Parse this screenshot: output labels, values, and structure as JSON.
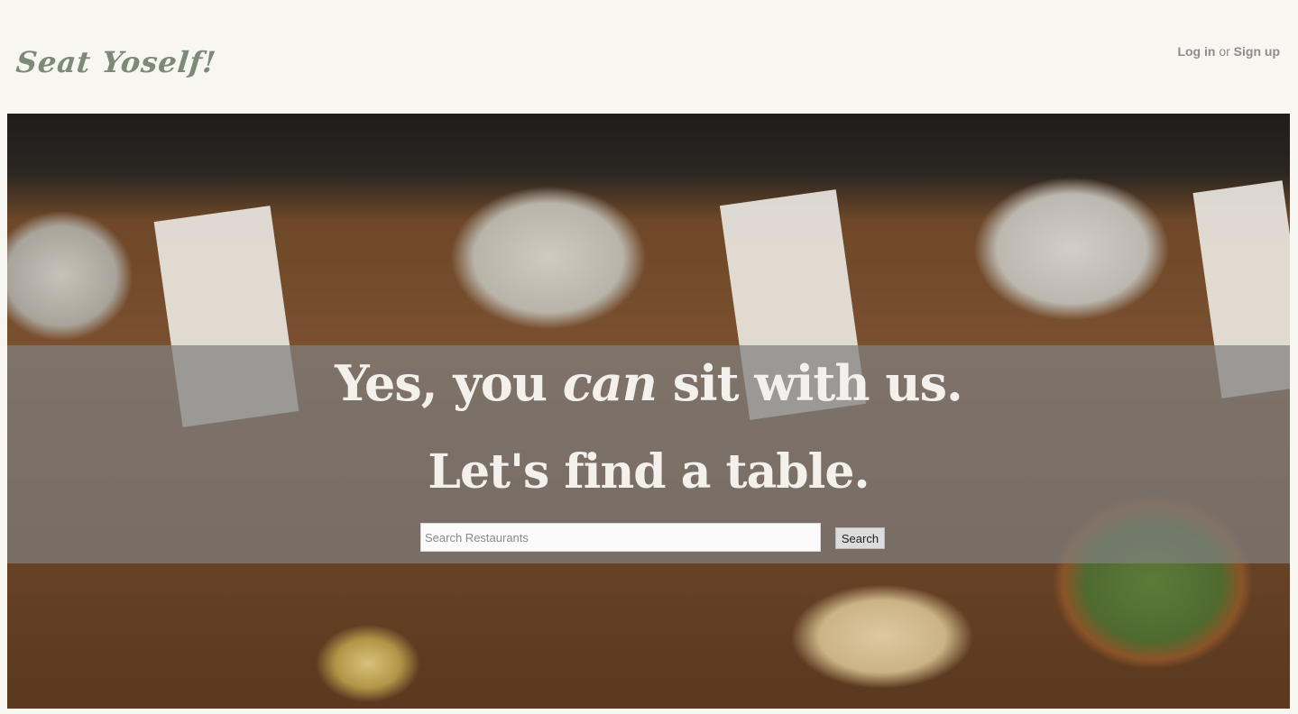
{
  "header": {
    "logo": "Seat Yoself!",
    "login_label": "Log in",
    "or_label": "or",
    "signup_label": "Sign up"
  },
  "hero": {
    "headline_part1": "Yes, you ",
    "headline_emphasis": "can",
    "headline_part2": " sit with us.",
    "subheadline": "Let's find a table.",
    "search": {
      "placeholder": "Search Restaurants",
      "value": "",
      "button_label": "Search"
    }
  },
  "colors": {
    "page_background": "#f8f6f0",
    "logo": "#7d8a78",
    "overlay": "#808080",
    "headline": "#f4f1ec"
  }
}
